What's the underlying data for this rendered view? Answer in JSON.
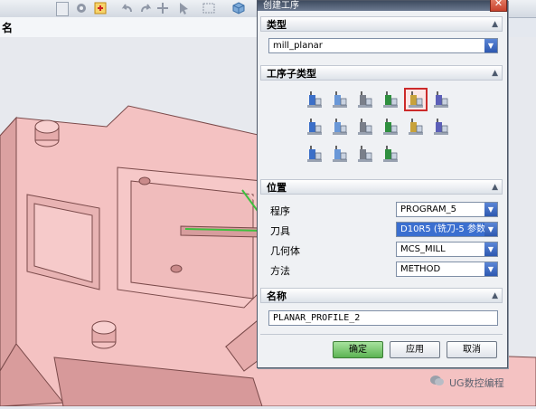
{
  "toolbar": {
    "icons": [
      "view-dropdown-icon",
      "snap-icon",
      "selection-filter-icon",
      "undo-icon",
      "redo-icon",
      "move-icon",
      "pointer-icon",
      "rectangle-select-icon",
      "cube-icon"
    ]
  },
  "namepanel": {
    "label": "名"
  },
  "dialog": {
    "title": "创建工序",
    "close_glyph": "✕",
    "type_section": {
      "label": "类型",
      "value": "mill_planar"
    },
    "subtype_section": {
      "label": "工序子类型",
      "selected_icon": "planar-profile-icon",
      "rows": [
        [
          "floor-wall-icon",
          "floor-wall-is-icon",
          "face-milling-icon",
          "planar-mill-icon",
          "planar-profile-icon",
          "cleanup-corners-icon"
        ],
        [
          "finish-walls-icon",
          "finish-floor-icon",
          "groove-milling-icon",
          "hole-milling-icon",
          "thread-milling-icon",
          "planar-text-icon"
        ],
        [
          "mill-control-icon",
          "mill-user-icon",
          "generic-motion-icon",
          "chamfer-icon"
        ]
      ]
    },
    "location_section": {
      "label": "位置",
      "fields": [
        {
          "label": "程序",
          "value": "PROGRAM_5"
        },
        {
          "label": "刀具",
          "value": "D10R5 (铣刀-5 参数)"
        },
        {
          "label": "几何体",
          "value": "MCS_MILL"
        },
        {
          "label": "方法",
          "value": "METHOD"
        }
      ]
    },
    "name_section": {
      "label": "名称",
      "value": "PLANAR_PROFILE_2"
    },
    "buttons": {
      "ok": "确定",
      "apply": "应用",
      "cancel": "取消"
    }
  },
  "watermark": {
    "text": "UG数控编程"
  },
  "colors": {
    "part": "#f4c2c2",
    "part_shade": "#e2a7a7",
    "highlight": "#3fbf3f",
    "selected_border": "#cc2a2a"
  }
}
